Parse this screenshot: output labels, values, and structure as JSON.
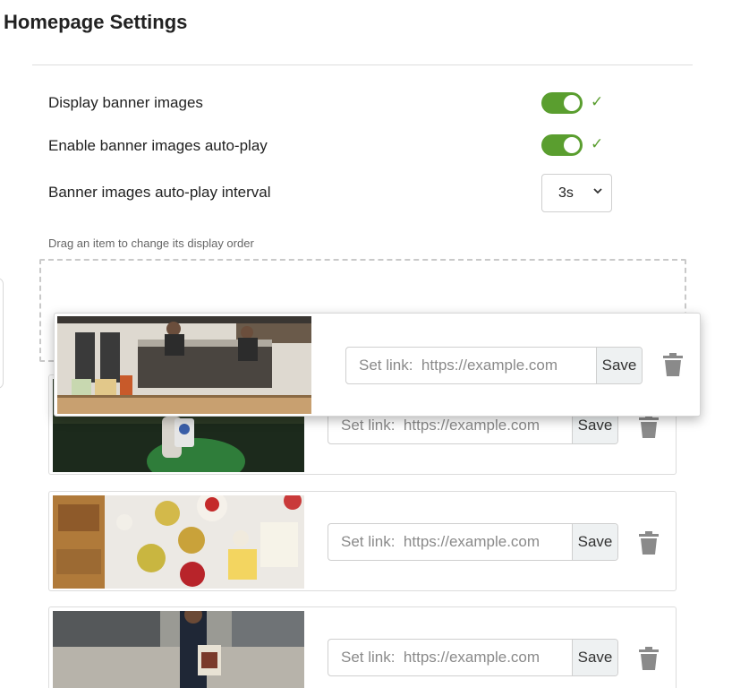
{
  "page": {
    "title": "Homepage Settings"
  },
  "settings": {
    "display_banner": {
      "label": "Display banner images",
      "enabled": true
    },
    "autoplay": {
      "label": "Enable banner images auto-play",
      "enabled": true
    },
    "interval": {
      "label": "Banner images auto-play interval",
      "value": "3s"
    }
  },
  "banners": {
    "hint": "Drag an item to change its display order",
    "link_placeholder": "Set link:  https://example.com",
    "save_label": "Save",
    "items": [
      {
        "image": "coffee-bar-espresso-machine"
      },
      {
        "image": "hand-holding-cup-green-sleeve"
      },
      {
        "image": "cheese-crackers-jam-platter"
      },
      {
        "image": "street-person-graffiti-bag"
      }
    ]
  },
  "colors": {
    "accent": "#5a9e2f",
    "save_bg": "#eef1f2",
    "border": "#dcdcdc"
  },
  "icons": [
    "check-icon",
    "chevron-down-icon",
    "trash-icon"
  ]
}
